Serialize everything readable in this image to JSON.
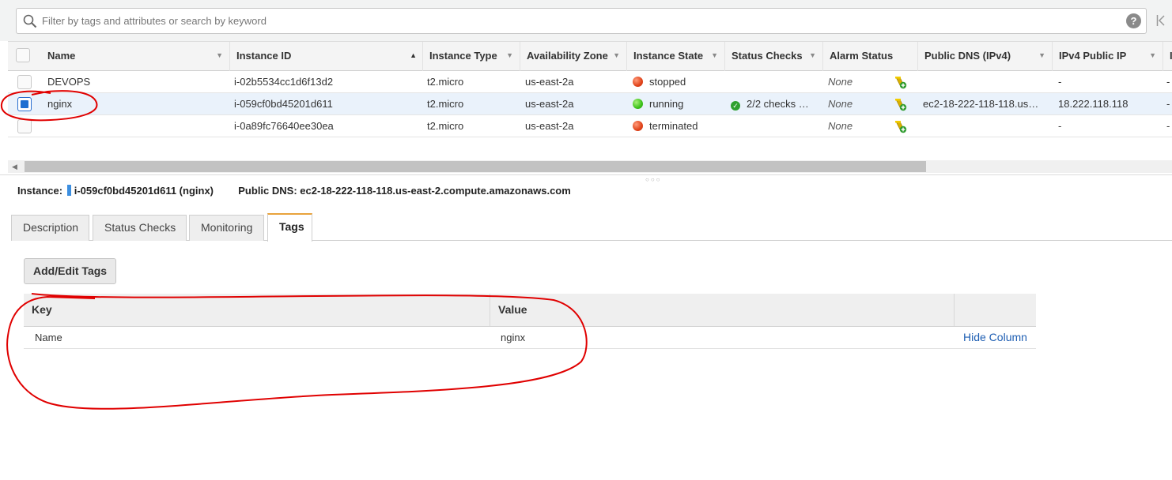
{
  "search": {
    "placeholder": "Filter by tags and attributes or search by keyword",
    "help_label": "?"
  },
  "table": {
    "columns": [
      "Name",
      "Instance ID",
      "Instance Type",
      "Availability Zone",
      "Instance State",
      "Status Checks",
      "Alarm Status",
      "Public DNS (IPv4)",
      "IPv4 Public IP",
      "I"
    ],
    "sorted_column": "Instance ID",
    "rows": [
      {
        "name": "DEVOPS",
        "instance_id": "i-02b5534cc1d6f13d2",
        "type": "t2.micro",
        "az": "us-east-2a",
        "state": "stopped",
        "state_color": "#e0431a",
        "status_checks": "",
        "alarm": "None",
        "dns": "",
        "ip": "-",
        "extra": "-",
        "selected": false
      },
      {
        "name": "nginx",
        "instance_id": "i-059cf0bd45201d611",
        "type": "t2.micro",
        "az": "us-east-2a",
        "state": "running",
        "state_color": "#3cc21a",
        "status_checks": "2/2 checks …",
        "alarm": "None",
        "dns": "ec2-18-222-118-118.us…",
        "ip": "18.222.118.118",
        "extra": "-",
        "selected": true
      },
      {
        "name": "",
        "instance_id": "i-0a89fc76640ee30ea",
        "type": "t2.micro",
        "az": "us-east-2a",
        "state": "terminated",
        "state_color": "#e0431a",
        "status_checks": "",
        "alarm": "None",
        "dns": "",
        "ip": "-",
        "extra": "-",
        "selected": false
      }
    ]
  },
  "detail": {
    "instance_label": "Instance:",
    "instance_value": "i-059cf0bd45201d611 (nginx)",
    "dns_label": "Public DNS:",
    "dns_value": "ec2-18-222-118-118.us-east-2.compute.amazonaws.com"
  },
  "tabs": [
    {
      "label": "Description",
      "active": false
    },
    {
      "label": "Status Checks",
      "active": false
    },
    {
      "label": "Monitoring",
      "active": false
    },
    {
      "label": "Tags",
      "active": true
    }
  ],
  "tags_panel": {
    "add_edit_label": "Add/Edit Tags",
    "key_header": "Key",
    "value_header": "Value",
    "rows": [
      {
        "key": "Name",
        "value": "nginx",
        "action": "Hide Column"
      }
    ]
  },
  "colors": {
    "accent_tab": "#e8a33c",
    "link": "#1f5fb3",
    "annotation": "#e00000"
  }
}
